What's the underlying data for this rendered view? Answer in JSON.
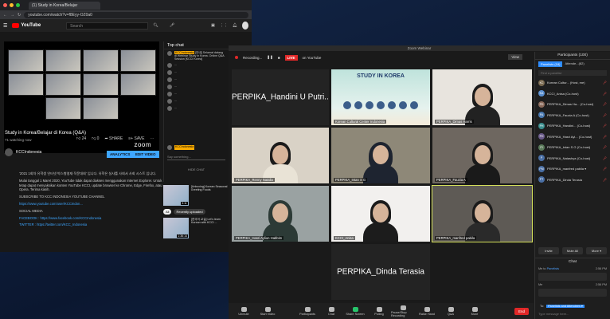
{
  "browser": {
    "tab_title": "(1) Study in Korea/Belajar",
    "url": "youtube.com/watch?v=f8Eyy-OZ0a0"
  },
  "youtube": {
    "logo": "YouTube",
    "search_placeholder": "Search",
    "video_title": "Study in Korea/Belajar di Korea (Q&A)",
    "watching": "71 watching now",
    "likes": "24",
    "dislikes": "0",
    "share": "SHARE",
    "save": "SAVE",
    "channel": "KCCIndonesia",
    "analytics_btn": "ANALYTICS",
    "edit_btn": "EDIT VIDEO",
    "zoom_brand": "zoom",
    "desc": [
      "‘2021 1회차 유학생 인터넷 박스형영재 작문대회’ 입니다. 유학은 실사를 사회서 사회 시스트 입니다.",
      "Mulai tanggal 1 Maret 2020, YouTube tidak dapat diakses menggunakan Internet Explorer. Untuk tetap dapat menyaksikan konten YouTube KCCI, update browser ke Chrome, Edge, Firefox, atau Opera. Terima kasih.",
      "SUBSCRIBE TO KCC INDONESIA YOUTUBE CHANNEL",
      "https://www.youtube.com/user/KCCIndon...",
      "SOCIAL MEDIA",
      "FACEBOOK : https://www.facebook.com/KCCIndonesia",
      "TWITTER : https://twitter.com/KCC_Indonesia"
    ],
    "chat": {
      "header": "Top chat",
      "messages": [
        {
          "name": "KCCIndonesia",
          "text": "[안내] Selamat datang di Webinar Study in Korea. Online Q&A Session [KCCI Korea]"
        },
        {
          "name": "",
          "text": "..."
        },
        {
          "name": "",
          "text": "..."
        },
        {
          "name": "",
          "text": "..."
        },
        {
          "name": "",
          "text": "..."
        },
        {
          "name": "",
          "text": "..."
        },
        {
          "name": "",
          "text": "..."
        },
        {
          "name": "",
          "text": "..."
        }
      ],
      "input_user": "KCCIndonesia",
      "input_placeholder": "Say something...",
      "footer": "HIDE CHAT"
    },
    "chips": [
      "All",
      "Recently uploaded"
    ],
    "recs": [
      {
        "title": "[Unboxing] Korean Seasonal Greeting Foods",
        "time": "3:11"
      },
      {
        "title": "[한국어 교실] Let's learn Korean with KCCI ...",
        "time": "1:36:14"
      }
    ]
  },
  "zoom": {
    "window_title": "Zoom Webinar",
    "recording": "Recording...",
    "live_badge": "LIVE",
    "live_on": "on YouTube",
    "view_btn": "View",
    "tiles": [
      {
        "name": "",
        "big": "PERPIKA_Handini U Putri..."
      },
      {
        "name": "Korean Cultural Center Indonesia",
        "big": "",
        "poster_title": "STUDY IN KOREA"
      },
      {
        "name": "PERPIKA_Dimas Harris",
        "big": ""
      },
      {
        "name": "PERPIKA_Renny Natalia",
        "big": ""
      },
      {
        "name": "PERPIKA_Intan S G",
        "big": ""
      },
      {
        "name": "PERPIKA_Fauzia A",
        "big": ""
      },
      {
        "name": "PERPIKA_Hasri Ayliun Habbim",
        "big": ""
      },
      {
        "name": "KCCI_Anisa",
        "big": ""
      },
      {
        "name": "PERPIKA_manfred pabila",
        "big": ""
      },
      {
        "name": "",
        "big": "PERPIKA_Dinda Terasia"
      }
    ],
    "bottom": [
      "Unmute",
      "Start Video",
      "Participants",
      "Chat",
      "Share Screen",
      "Polling",
      "Pause/Stop Recording",
      "Raise Hand",
      "Q&A",
      "More"
    ],
    "end_btn": "End",
    "participants": {
      "header": "Participants (100)",
      "tab_panelists": "Panelists (18)",
      "tab_attendees": "Attende...(82)",
      "search_placeholder": "Find a panelist",
      "rows": [
        {
          "initials": "KC",
          "name": "Korean Cultur... (Host, me)"
        },
        {
          "initials": "KA",
          "name": "KCCI_Anisa (Co-host)"
        },
        {
          "initials": "PD",
          "name": "PERPIKA_Dimas Ha... (Co-host)"
        },
        {
          "initials": "PA",
          "name": "PERPIKA_Fauzia A (Co-host)"
        },
        {
          "initials": "PH",
          "name": "PERPIKA_Handini... (Co-host)"
        },
        {
          "initials": "PH",
          "name": "PERPIKA_Hasri Ayl... (Co-host)"
        },
        {
          "initials": "PI",
          "name": "PERPIKA_Intan S G (Co-host)"
        },
        {
          "initials": "P",
          "name": "PERPIKA_Natashya (Co-host)"
        },
        {
          "initials": "PM",
          "name": "PERPIKA_manfred pabila ▾"
        },
        {
          "initials": "PT",
          "name": "PERPIKA_Dinda Terasia"
        }
      ],
      "btn_invite": "Invite",
      "btn_mute": "Mute All",
      "btn_more": "More ▾"
    },
    "chat": {
      "header": "Chat",
      "messages": [
        {
          "from": "Me",
          "to": "Panelists",
          "time": "2:56 PM"
        },
        {
          "from": "Me",
          "to": "",
          "time": "2:56 PM"
        }
      ],
      "to_label": "To:",
      "to_target": "Panelists and Attendees ▾",
      "input_placeholder": "Type message here..."
    }
  }
}
